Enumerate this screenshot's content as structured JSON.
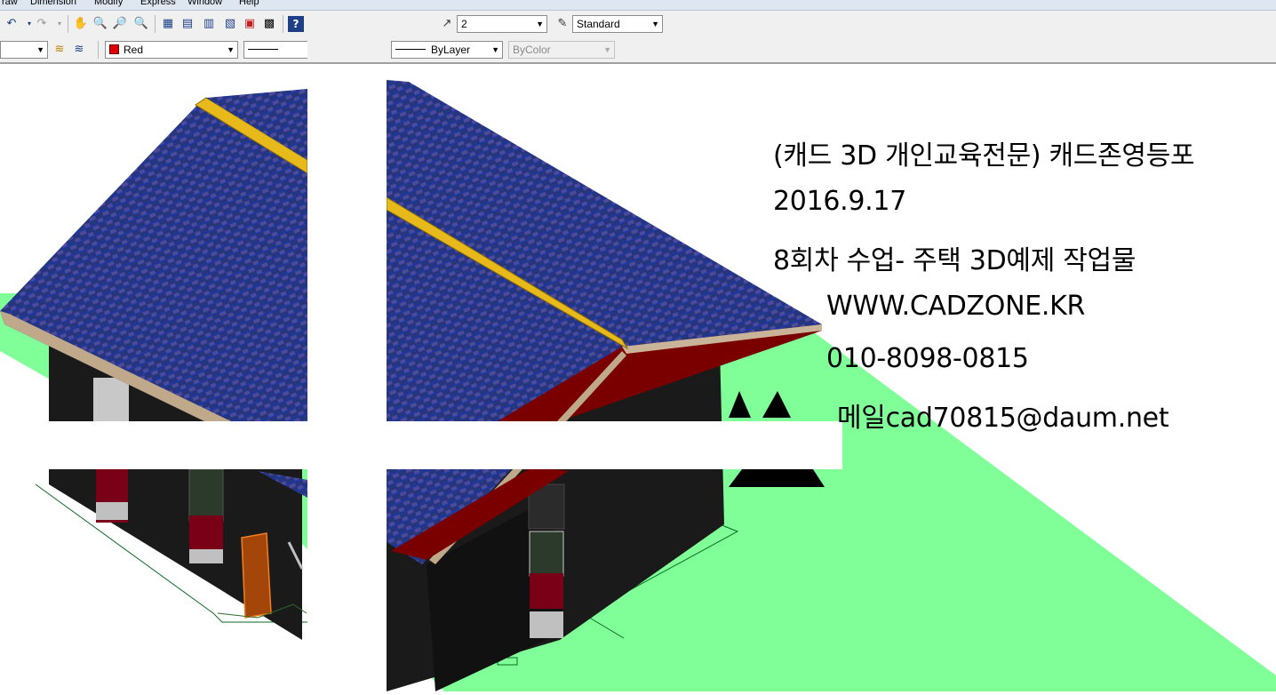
{
  "menu": {
    "items": [
      "raw",
      "Dimension",
      "Modify",
      "Express",
      "Window",
      "Help"
    ]
  },
  "toolbar": {
    "dimstyle_value": "2",
    "textstyle_value": "Standard",
    "layer_color_value": "Red",
    "linetype_value": "ByLayer",
    "plotstyle_value": "ByColor"
  },
  "icons": [
    "undo-icon",
    "redo-icon",
    "pan-icon",
    "zoom-realtime-icon",
    "zoom-window-icon",
    "zoom-previous-icon",
    "properties-icon",
    "design-center-icon",
    "tool-palettes-icon",
    "sheet-set-icon",
    "markup-icon",
    "calculator-icon",
    "help-icon",
    "dimstyle-icon",
    "textstyle-icon",
    "layer-states-icon",
    "layer-previous-icon"
  ],
  "annotation": {
    "line1": "(캐드 3D 개인교육전문) 캐드존영등포",
    "line2": "2016.9.17",
    "line3": "8회차 수업- 주택 3D예제 작업물",
    "line4": "WWW.CADZONE.KR",
    "line5": "010-8098-0815",
    "line6": "메일cad70815@daum.net"
  },
  "colors": {
    "ground": "#80ff99",
    "roof_tile": "#2a3f8a",
    "ridge": "#e8b91a",
    "gable": "#7a0000",
    "wall": "#1c1c1c"
  }
}
